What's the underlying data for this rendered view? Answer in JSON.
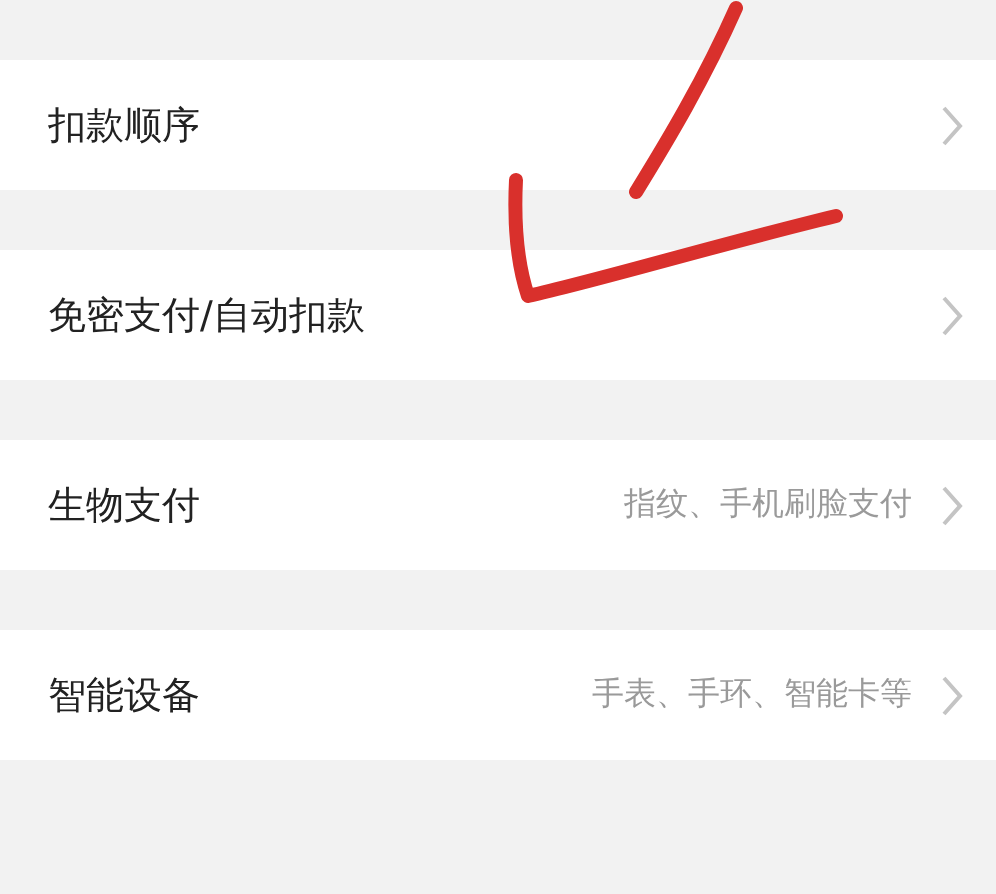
{
  "settings": [
    {
      "label": "扣款顺序"
    },
    {
      "label": "免密支付/自动扣款"
    },
    {
      "label": "生物支付",
      "value": "指纹、手机刷脸支付"
    },
    {
      "label": "智能设备",
      "value": "手表、手环、智能卡等"
    }
  ]
}
